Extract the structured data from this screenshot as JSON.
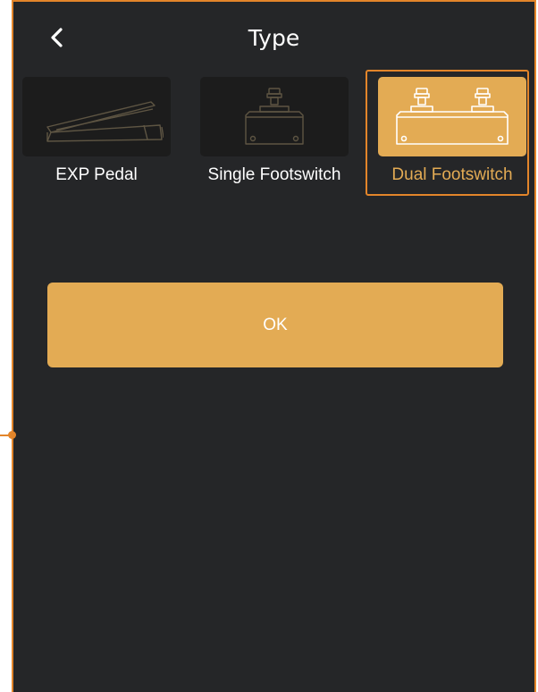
{
  "header": {
    "title": "Type",
    "back_icon": "chevron-left-icon"
  },
  "types": [
    {
      "label": "EXP Pedal",
      "icon": "exp-pedal-icon",
      "selected": false
    },
    {
      "label": "Single Footswitch",
      "icon": "single-footswitch-icon",
      "selected": false
    },
    {
      "label": "Dual Footswitch",
      "icon": "dual-footswitch-icon",
      "selected": true
    }
  ],
  "ok_button": {
    "label": "OK"
  },
  "colors": {
    "background": "#252628",
    "accent": "#e3ab54",
    "highlight": "#e3852a",
    "text": "#ffffff"
  }
}
